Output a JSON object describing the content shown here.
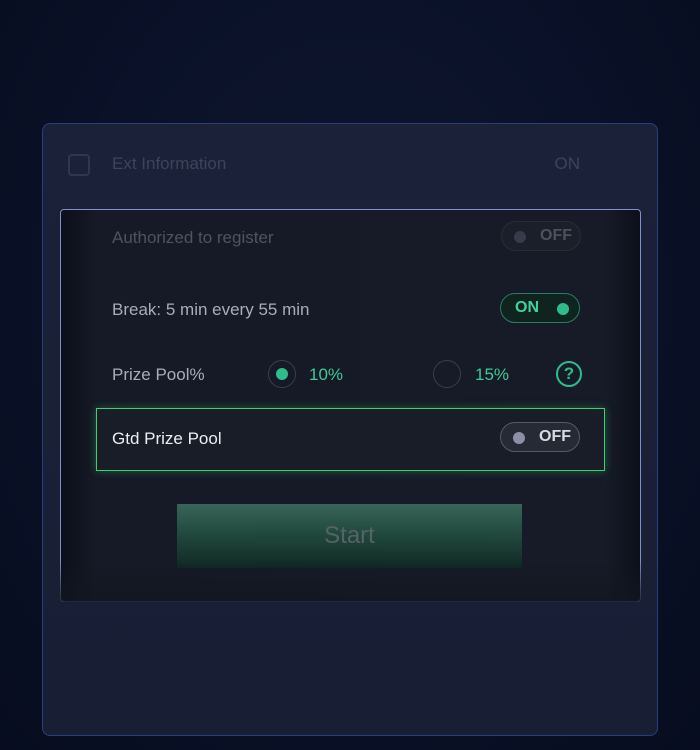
{
  "background_row": {
    "title": "Ext Information",
    "right_text": "ON"
  },
  "settings": {
    "authorized_to_register": {
      "label": "Authorized to register",
      "state": "OFF"
    },
    "break": {
      "label": "Break: 5 min every 55 min",
      "state": "ON"
    },
    "prize_pool": {
      "label": "Prize Pool%",
      "options": [
        "10%",
        "15%"
      ],
      "selected": "10%",
      "help_icon": "?"
    },
    "gtd_prize_pool": {
      "label": "Gtd Prize Pool",
      "state": "OFF"
    }
  },
  "start_button": {
    "label": "Start"
  },
  "colors": {
    "accent_green": "#2ebc8a",
    "highlight_border": "#3fd06a",
    "panel_border": "#7e8fd4"
  }
}
